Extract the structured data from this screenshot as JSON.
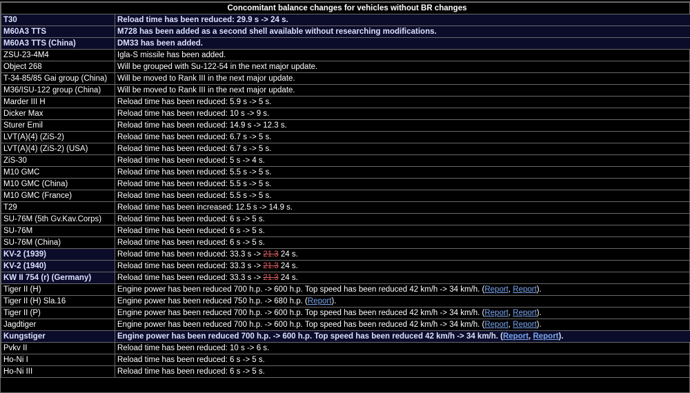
{
  "title": "Concomitant balance changes for vehicles without BR changes",
  "rows": [
    {
      "vehicle": "T30",
      "change": "Reload time has been reduced: 29.9 s -> 24 s.",
      "highlight": true
    },
    {
      "vehicle": "M60A3 TTS",
      "change": "M728 has been added as a second shell available without researching modifications.",
      "highlight": true
    },
    {
      "vehicle": "M60A3 TTS (China)",
      "change": "DM33 has been added.",
      "highlight": true
    },
    {
      "vehicle": "ZSU-23-4M4",
      "change": "Igla-S missile has been added.",
      "highlight": false
    },
    {
      "vehicle": "Object 268",
      "change": "Will be grouped with Su-122-54 in the next major update.",
      "highlight": false
    },
    {
      "vehicle": "T-34-85/85 Gai group (China)",
      "change": "Will be moved to Rank III in the next major update.",
      "highlight": false
    },
    {
      "vehicle": "M36/ISU-122 group (China)",
      "change": "Will be moved to Rank III in the next major update.",
      "highlight": false
    },
    {
      "vehicle": "Marder III H",
      "change": "Reload time has been reduced: 5.9 s -> 5 s.",
      "highlight": false
    },
    {
      "vehicle": "Dicker Max",
      "change": "Reload time has been reduced: 10 s -> 9 s.",
      "highlight": false
    },
    {
      "vehicle": "Sturer Emil",
      "change": "Reload time has been reduced: 14.9 s -> 12.3 s.",
      "highlight": false
    },
    {
      "vehicle": "LVT(A)(4) (ZiS-2)",
      "change": "Reload time has been reduced: 6.7 s -> 5 s.",
      "highlight": false
    },
    {
      "vehicle": "LVT(A)(4) (ZiS-2) (USA)",
      "change": "Reload time has been reduced: 6.7 s -> 5 s.",
      "highlight": false
    },
    {
      "vehicle": "ZiS-30",
      "change": "Reload time has been reduced: 5 s -> 4 s.",
      "highlight": false
    },
    {
      "vehicle": "M10 GMC",
      "change": "Reload time has been reduced: 5.5 s -> 5 s.",
      "highlight": false
    },
    {
      "vehicle": "M10 GMC (China)",
      "change": "Reload time has been reduced: 5.5 s -> 5 s.",
      "highlight": false
    },
    {
      "vehicle": "M10 GMC (France)",
      "change": "Reload time has been reduced: 5.5 s -> 5 s.",
      "highlight": false
    },
    {
      "vehicle": "T29",
      "change": "Reload time has been increased: 12.5 s -> 14.9 s.",
      "highlight": false
    },
    {
      "vehicle": "SU-76M (5th Gv.Kav.Corps)",
      "change": "Reload time has been reduced: 6 s -> 5 s.",
      "highlight": false
    },
    {
      "vehicle": "SU-76M",
      "change": "Reload time has been reduced: 6 s -> 5 s.",
      "highlight": false
    },
    {
      "vehicle": "SU-76M (China)",
      "change": "Reload time has been reduced: 6 s -> 5 s.",
      "highlight": false
    },
    {
      "vehicle": "KV-2 (1939)",
      "change": "Reload time has been reduced: 33.3 s -> ",
      "struck": "21.3",
      "after": " 24 s.",
      "highlight": true,
      "vehicle_only_highlight": true
    },
    {
      "vehicle": "KV-2 (1940)",
      "change": "Reload time has been reduced: 33.3 s -> ",
      "struck": "21.3",
      "after": " 24 s.",
      "highlight": true,
      "vehicle_only_highlight": true
    },
    {
      "vehicle": "KW II 754 (r) (Germany)",
      "change": "Reload time has been reduced: 33.3 s -> ",
      "struck": "21.3",
      "after": " 24 s.",
      "highlight": true,
      "vehicle_only_highlight": true
    },
    {
      "vehicle": "Tiger II (H)",
      "change": "Engine power has been reduced 700 h.p. -> 600 h.p. Top speed has been reduced 42 km/h -> 34 km/h. (",
      "links": [
        "Report",
        "Report"
      ],
      "after": ").",
      "highlight": false
    },
    {
      "vehicle": "Tiger II (H) Sla.16",
      "change": "Engine power has been reduced 750 h.p. -> 680 h.p. (",
      "links": [
        "Report"
      ],
      "after": ").",
      "highlight": false
    },
    {
      "vehicle": "Tiger II (P)",
      "change": "Engine power has been reduced 700 h.p. -> 600 h.p. Top speed has been reduced 42 km/h -> 34 km/h. (",
      "links": [
        "Report",
        "Report"
      ],
      "after": ").",
      "highlight": false
    },
    {
      "vehicle": "Jagdtiger",
      "change": "Engine power has been reduced 700 h.p. -> 600 h.p. Top speed has been reduced 42 km/h -> 34 km/h. (",
      "links": [
        "Report",
        "Report"
      ],
      "after": ").",
      "highlight": false
    },
    {
      "vehicle": "Kungstiger",
      "change": "Engine power has been reduced 700 h.p. -> 600 h.p. Top speed has been reduced 42 km/h -> 34 km/h. (",
      "links": [
        "Report",
        "Report"
      ],
      "after": ").",
      "highlight": true
    },
    {
      "vehicle": "Pvkv II",
      "change": "Reload time has been reduced: 10 s -> 6 s.",
      "highlight": false
    },
    {
      "vehicle": "Ho-Ni I",
      "change": "Reload time has been reduced: 6 s -> 5 s.",
      "highlight": false
    },
    {
      "vehicle": "Ho-Ni III",
      "change": "Reload time has been reduced: 6 s -> 5 s.",
      "highlight": false
    }
  ]
}
